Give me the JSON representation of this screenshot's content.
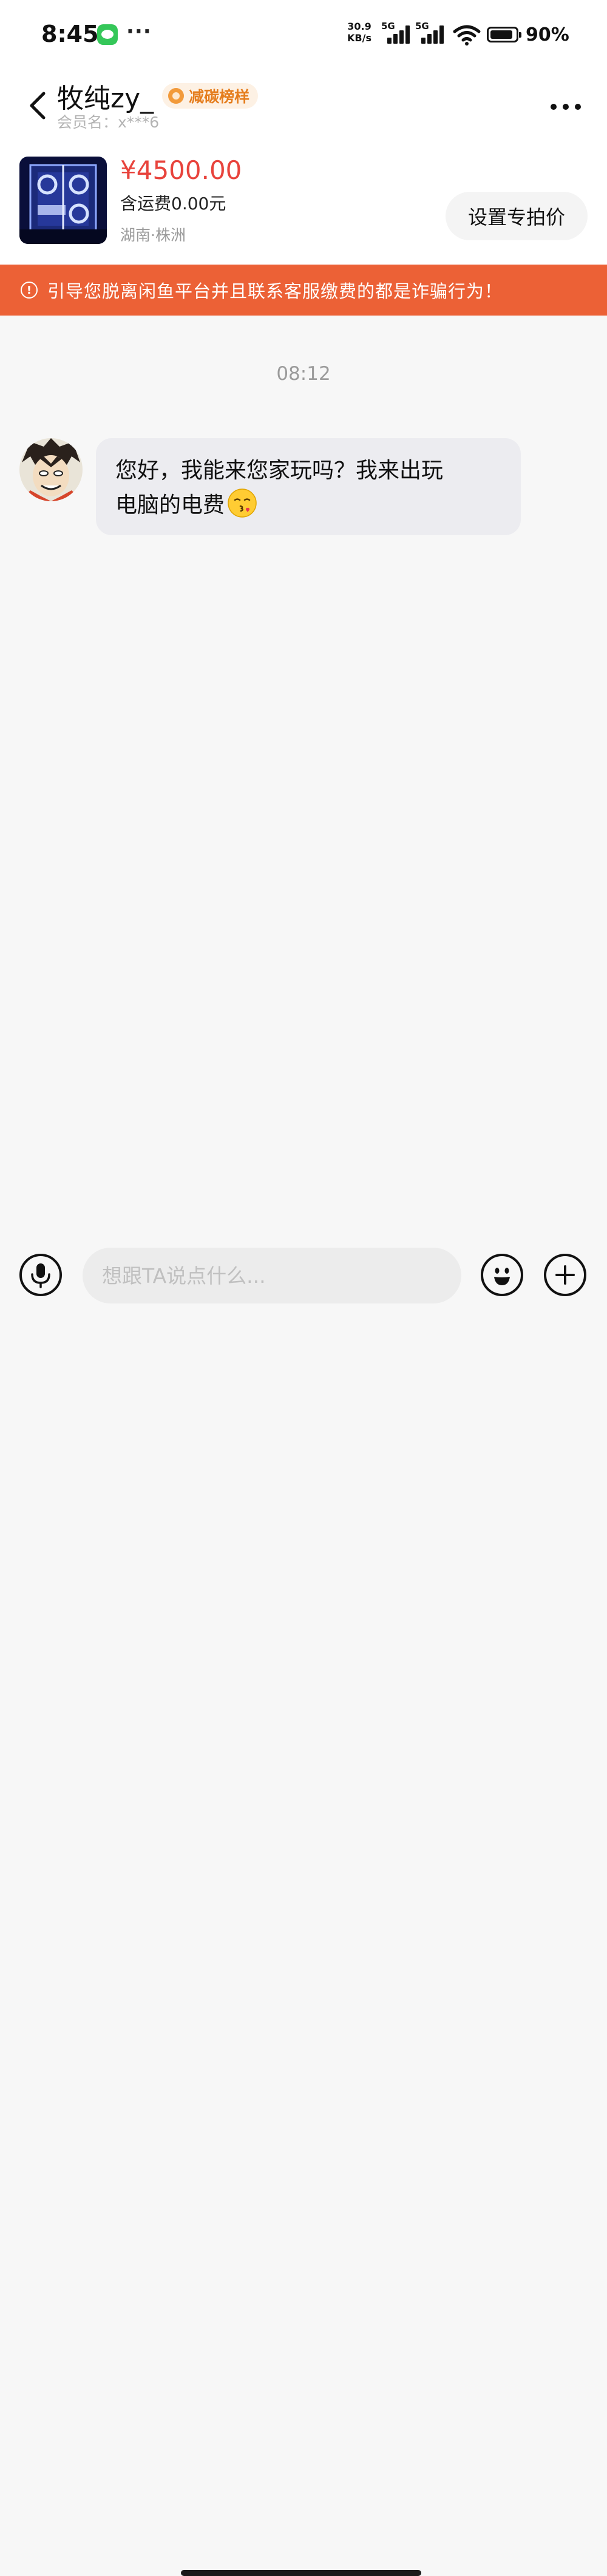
{
  "status_bar": {
    "time": "8:45",
    "more_dots": "···",
    "net_speed_value": "30.9",
    "net_speed_unit": "KB/s",
    "signal_1_label": "5G",
    "signal_2_label": "5G",
    "battery_percent": "90%",
    "battery_level": 0.9
  },
  "header": {
    "contact_name": "牧纯zy_",
    "badge_label": "减碳榜样",
    "member_name": "会员名：x***6"
  },
  "product": {
    "price": "¥4500.00",
    "shipping": "含运费0.00元",
    "location": "湖南·株洲",
    "set_price_button": "设置专拍价"
  },
  "warning": {
    "text": "引导您脱离闲鱼平台并且联系客服缴费的都是诈骗行为！"
  },
  "chat": {
    "timestamp": "08:12",
    "messages": [
      {
        "line_1": "您好，我能来您家玩吗？我来出玩",
        "line_2": "电脑的电费",
        "emoji": "kiss-emoji"
      }
    ]
  },
  "input_bar": {
    "placeholder": "想跟TA说点什么..."
  },
  "colors": {
    "price_red": "#e8433c",
    "warning_orange": "#ec6136",
    "badge_text": "#e57d1d",
    "bubble_bg": "#ececf0"
  }
}
